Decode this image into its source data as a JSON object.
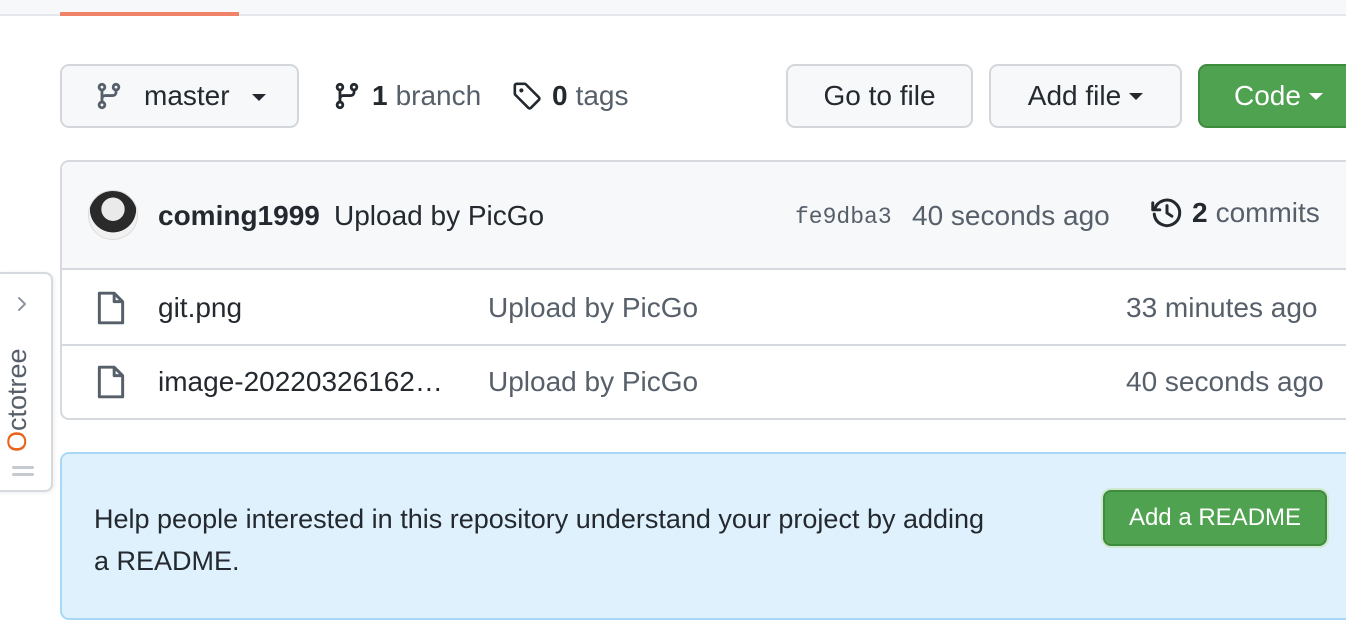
{
  "branch": {
    "current": "master"
  },
  "stats": {
    "branch_count": "1",
    "branch_label": "branch",
    "tag_count": "0",
    "tag_label": "tags"
  },
  "actions": {
    "go_to_file": "Go to file",
    "add_file": "Add file",
    "code": "Code"
  },
  "latest_commit": {
    "author": "coming1999",
    "message": "Upload by PicGo",
    "sha": "fe9dba3",
    "time": "40 seconds ago",
    "commit_count": "2",
    "commit_label": "commits"
  },
  "files": [
    {
      "name": "git.png",
      "message": "Upload by PicGo",
      "time": "33 minutes ago"
    },
    {
      "name": "image-20220326162…",
      "message": "Upload by PicGo",
      "time": "40 seconds ago"
    }
  ],
  "readme_prompt": {
    "text": "Help people interested in this repository understand your project by adding a README.",
    "button": "Add a README"
  },
  "octotree": {
    "label_first": "O",
    "label_rest": "ctotree"
  },
  "colors": {
    "primary_green": "#4fa24f",
    "accent_tab": "#f0826a",
    "readme_bg": "#def1fd",
    "octotree_accent": "#e8641b"
  }
}
